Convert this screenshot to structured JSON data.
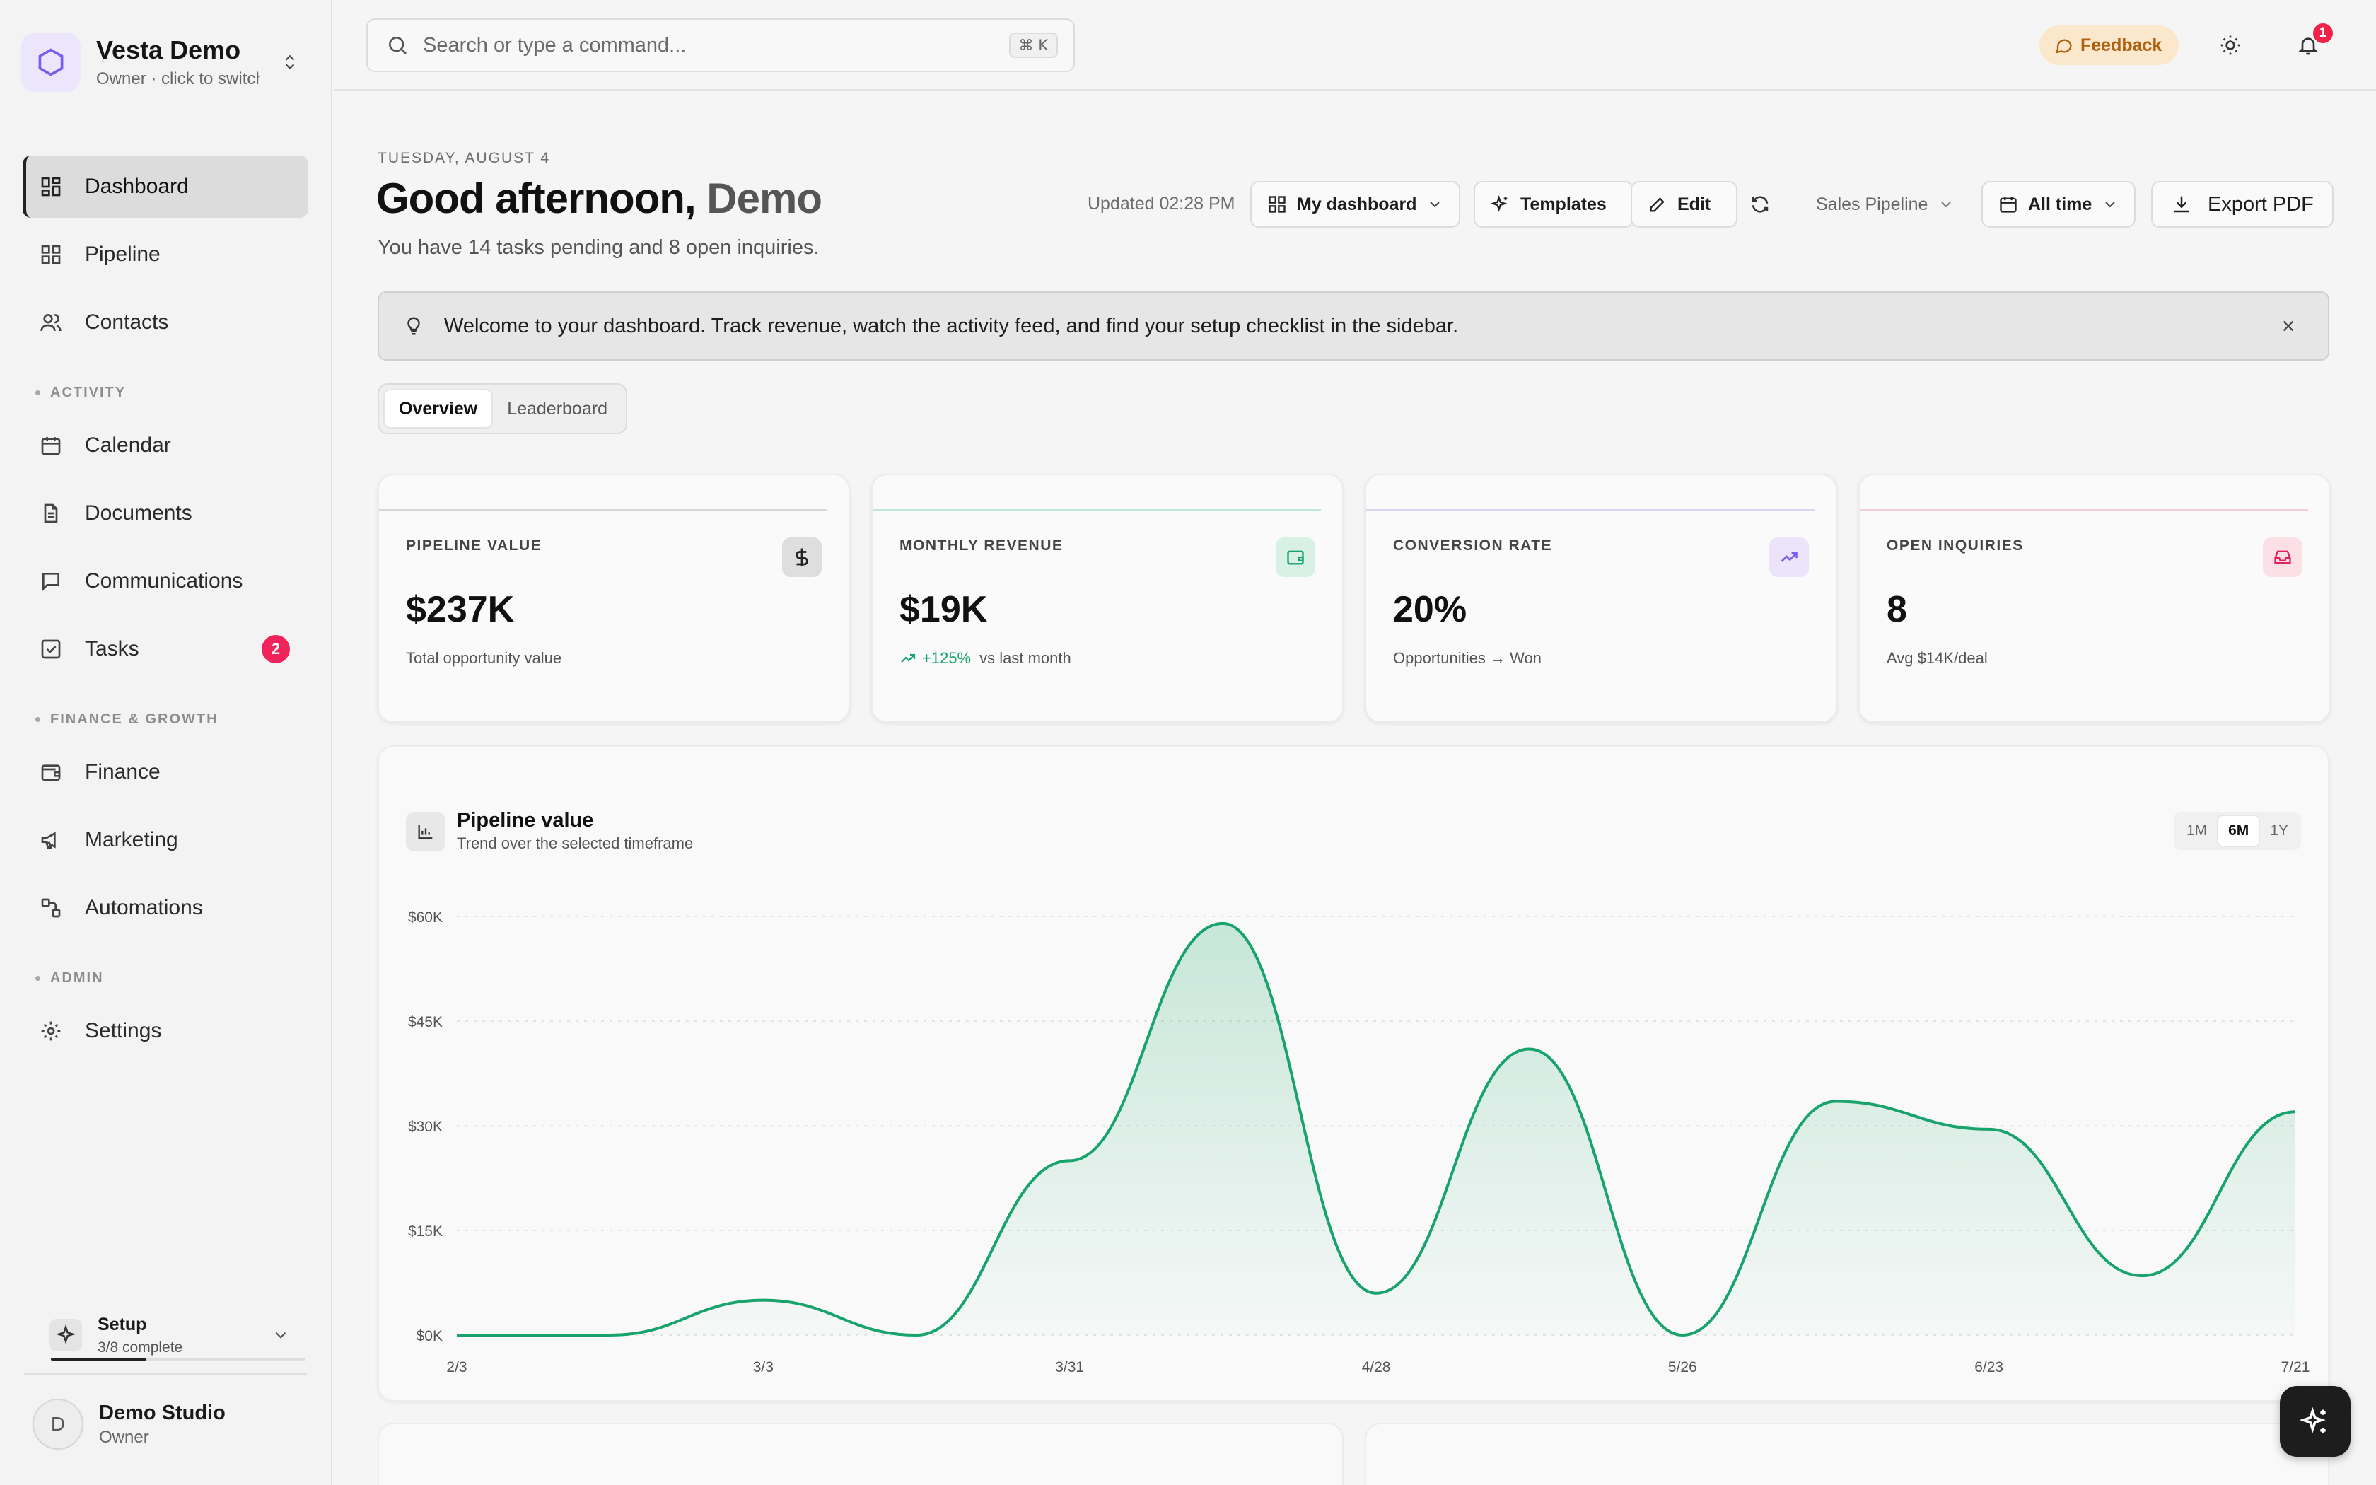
{
  "workspace": {
    "name": "Vesta Demo",
    "subtitle": "Owner · click to switch"
  },
  "sidebar": {
    "items": [
      {
        "label": "Dashboard"
      },
      {
        "label": "Pipeline"
      },
      {
        "label": "Contacts"
      },
      {
        "label": "Calendar"
      },
      {
        "label": "Documents"
      },
      {
        "label": "Communications"
      },
      {
        "label": "Tasks",
        "badge": "2"
      },
      {
        "label": "Finance"
      },
      {
        "label": "Marketing"
      },
      {
        "label": "Automations"
      },
      {
        "label": "Settings"
      }
    ],
    "sections": {
      "activity": "ACTIVITY",
      "finance": "FINANCE & GROWTH",
      "admin": "ADMIN"
    },
    "setup": {
      "title": "Setup",
      "progress": "3/8 complete",
      "fraction": 0.375
    },
    "user": {
      "initial": "D",
      "name": "Demo Studio",
      "role": "Owner"
    }
  },
  "header": {
    "search_placeholder": "Search or type a command...",
    "shortcut": "⌘ K",
    "feedback_label": "Feedback",
    "notification_count": "1"
  },
  "main": {
    "date": "TUESDAY, AUGUST 4",
    "greeting": "Good afternoon,",
    "greeting_name": "Demo",
    "subtitle": "You have 14 tasks pending and 8 open inquiries.",
    "toolbar": {
      "updated": "Updated 02:28 PM",
      "dashboard_select": "My dashboard",
      "templates": "Templates",
      "edit": "Edit",
      "pipeline_select": "Sales Pipeline",
      "range_select": "All time",
      "export": "Export PDF"
    },
    "banner": "Welcome to your dashboard. Track revenue, watch the activity feed, and find your setup checklist in the sidebar.",
    "tabs": [
      "Overview",
      "Leaderboard"
    ],
    "stats": [
      {
        "label": "PIPELINE VALUE",
        "value": "$237K",
        "sub": "Total opportunity value",
        "icon": "dollar-icon",
        "accent": "#cfcfcf"
      },
      {
        "label": "MONTHLY REVENUE",
        "value": "$19K",
        "trend": "+125%",
        "sub": "vs last month",
        "icon": "wallet-icon",
        "accent": "#b5e6cf"
      },
      {
        "label": "CONVERSION RATE",
        "value": "20%",
        "sub": "Opportunities → Won",
        "icon": "trending-up-icon",
        "accent": "#d9cdf5"
      },
      {
        "label": "OPEN INQUIRIES",
        "value": "8",
        "sub": "Avg $14K/deal",
        "icon": "inbox-icon",
        "accent": "#f6c6d2"
      }
    ],
    "chart": {
      "title": "Pipeline value",
      "subtitle": "Trend over the selected timeframe",
      "ranges": [
        "1M",
        "6M",
        "1Y"
      ],
      "active_range": "6M"
    }
  },
  "colors": {
    "accent_green": "#17a36b",
    "badge_red": "#f0245b",
    "brand_purple": "#7b5cf0"
  },
  "chart_data": {
    "type": "area",
    "title": "Pipeline value",
    "x_ticks": [
      "2/3",
      "3/3",
      "3/31",
      "4/28",
      "5/26",
      "6/23",
      "7/21"
    ],
    "y_ticks": [
      "$0K",
      "$15K",
      "$30K",
      "$45K",
      "$60K"
    ],
    "ylim": [
      0,
      60000
    ],
    "x": [
      "2/3",
      "3/3",
      "3/17",
      "3/31",
      "4/14",
      "4/28",
      "5/12",
      "5/26",
      "6/9",
      "6/23",
      "7/7",
      "7/21",
      "8/4"
    ],
    "y": [
      0,
      0,
      5000,
      0,
      25000,
      59000,
      6000,
      41000,
      0,
      33500,
      29500,
      8500,
      32000
    ],
    "grid": true,
    "color": "#17a36b"
  }
}
